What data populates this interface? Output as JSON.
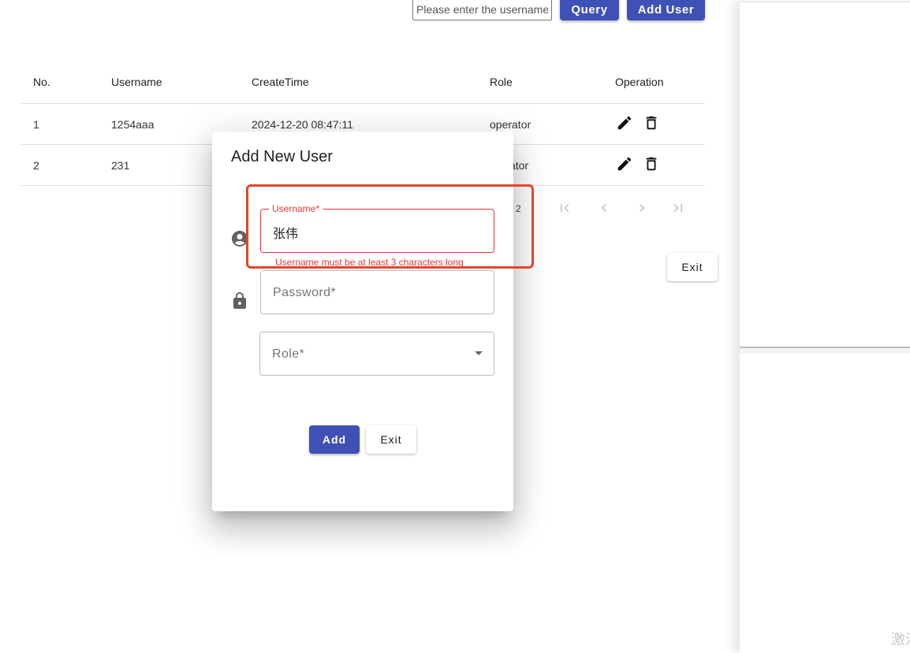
{
  "toolbar": {
    "search_placeholder": "Please enter the username",
    "query_label": "Query",
    "add_user_label": "Add User"
  },
  "table": {
    "headers": [
      "No.",
      "Username",
      "CreateTime",
      "Role",
      "Operation"
    ],
    "rows": [
      {
        "no": "1",
        "username": "1254aaa",
        "create_time": "2024-12-20 08:47:11",
        "role": "operator",
        "op_icons": [
          "edit-icon",
          "delete-icon"
        ]
      },
      {
        "no": "2",
        "username": "231",
        "create_time": "",
        "role": "operator",
        "op_icons": [
          "edit-icon",
          "delete-icon"
        ]
      }
    ],
    "row_2_role_visible": "ator"
  },
  "pagination": {
    "count_text": "2",
    "icons": [
      "first-page-icon",
      "prev-page-icon",
      "next-page-icon",
      "last-page-icon"
    ]
  },
  "page": {
    "exit_label": "Exit"
  },
  "dialog": {
    "title": "Add New User",
    "username": {
      "label": "Username*",
      "value": "张伟",
      "error": "Username must be at least 3 characters long",
      "icon": "account-circle-icon"
    },
    "password": {
      "placeholder": "Password*",
      "icon": "lock-icon"
    },
    "role": {
      "placeholder": "Role*",
      "icon": "dropdown-arrow-icon"
    },
    "add_label": "Add",
    "exit_label": "Exit"
  },
  "watermark": "激活",
  "colors": {
    "primary": "#3f51b5",
    "error": "#e53935",
    "highlight": "#e2452b"
  }
}
